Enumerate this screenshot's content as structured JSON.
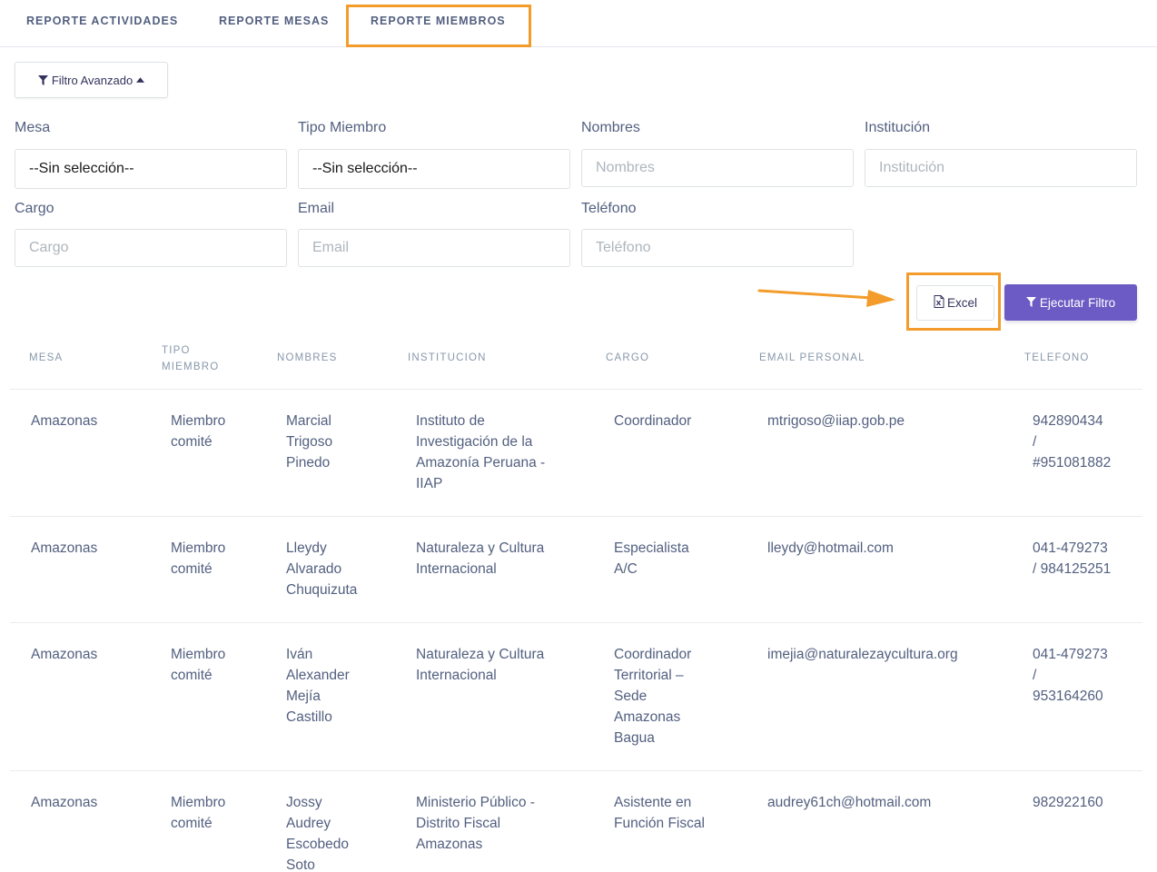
{
  "tabs": [
    {
      "label": "REPORTE ACTIVIDADES"
    },
    {
      "label": "REPORTE MESAS"
    },
    {
      "label": "REPORTE MIEMBROS"
    }
  ],
  "advanced_filter_label": "Filtro Avanzado",
  "filters": {
    "mesa": {
      "label": "Mesa",
      "value": "--Sin selección--"
    },
    "tipo_miembro": {
      "label": "Tipo Miembro",
      "value": "--Sin selección--"
    },
    "nombres": {
      "label": "Nombres",
      "placeholder": "Nombres"
    },
    "institucion": {
      "label": "Institución",
      "placeholder": "Institución"
    },
    "cargo": {
      "label": "Cargo",
      "placeholder": "Cargo"
    },
    "email": {
      "label": "Email",
      "placeholder": "Email"
    },
    "telefono": {
      "label": "Teléfono",
      "placeholder": "Teléfono"
    }
  },
  "actions": {
    "excel_label": "Excel",
    "run_label": "Ejecutar Filtro"
  },
  "table": {
    "headers": [
      "MESA",
      "TIPO\nMIEMBRO",
      "NOMBRES",
      "INSTITUCION",
      "CARGO",
      "EMAIL PERSONAL",
      "TELEFONO"
    ],
    "rows": [
      {
        "mesa": "Amazonas",
        "tipo": "Miembro\ncomité",
        "nombres": "Marcial\nTrigoso\nPinedo",
        "institucion": "Instituto de\nInvestigación de la\nAmazonía Peruana -\nIIAP",
        "cargo": "Coordinador",
        "email": "mtrigoso@iiap.gob.pe",
        "telefono": "942890434\n/\n#951081882"
      },
      {
        "mesa": "Amazonas",
        "tipo": "Miembro\ncomité",
        "nombres": "Lleydy\nAlvarado\nChuquizuta",
        "institucion": "Naturaleza y Cultura\nInternacional",
        "cargo": "Especialista\nA/C",
        "email": "lleydy@hotmail.com",
        "telefono": "041-479273\n/ 984125251"
      },
      {
        "mesa": "Amazonas",
        "tipo": "Miembro\ncomité",
        "nombres": "Iván\nAlexander\nMejía\nCastillo",
        "institucion": "Naturaleza y Cultura\nInternacional",
        "cargo": "Coordinador\nTerritorial –\nSede\nAmazonas\nBagua",
        "email": "imejia@naturalezaycultura.org",
        "telefono": "041-479273\n/\n953164260"
      },
      {
        "mesa": "Amazonas",
        "tipo": "Miembro\ncomité",
        "nombres": "Jossy\nAudrey\nEscobedo\nSoto",
        "institucion": "Ministerio Público -\nDistrito Fiscal\nAmazonas",
        "cargo": "Asistente en\nFunción Fiscal",
        "email": "audrey61ch@hotmail.com",
        "telefono": "982922160"
      }
    ]
  },
  "colors": {
    "highlight": "#f39c2b",
    "primary_button": "#6c5bc4"
  },
  "icons": [
    "filter-icon",
    "caret-up-icon",
    "excel-file-icon",
    "annotation-arrow"
  ]
}
